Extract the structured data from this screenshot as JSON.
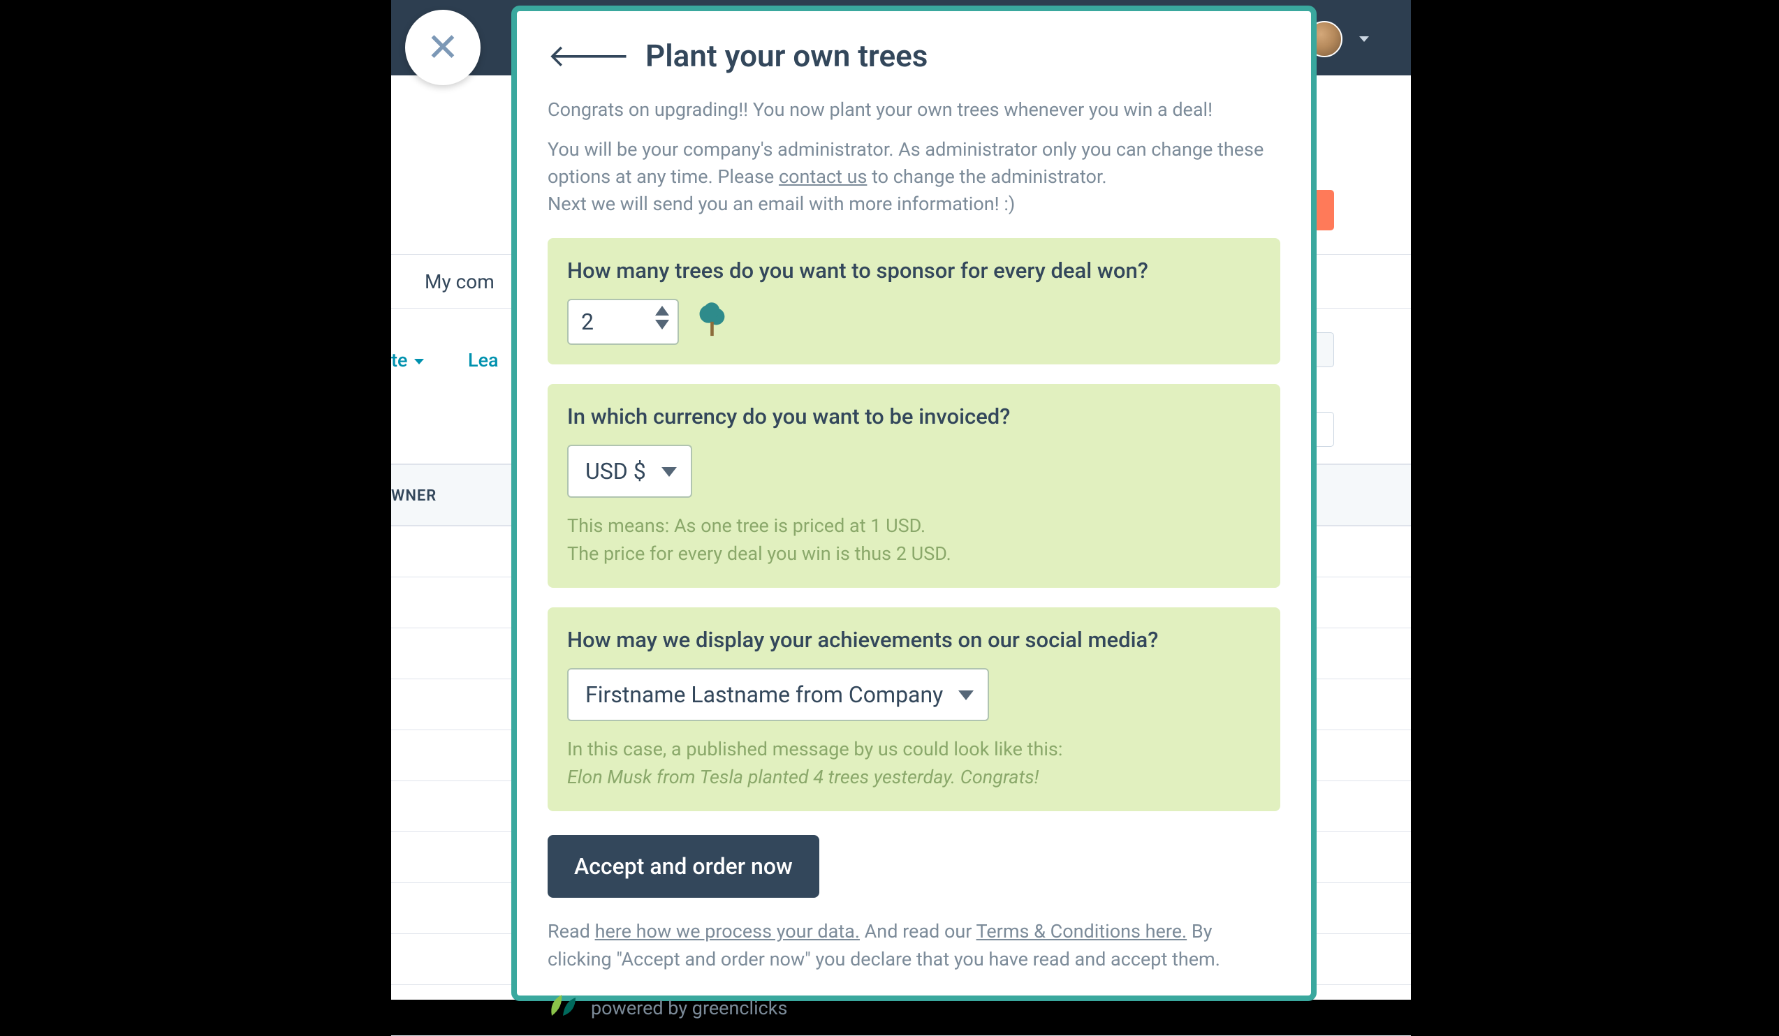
{
  "modal": {
    "title": "Plant your own trees",
    "intro1": "Congrats on upgrading!! You now plant your own trees whenever you win a deal!",
    "intro2a": "You will be your company's administrator. As administrator only you can change these options at any time. Please ",
    "contact_link": "contact us",
    "intro2b": "  to change the administrator.",
    "intro3": "Next we will send you an email with more information! :)"
  },
  "trees": {
    "question": "How many trees do you want to sponsor for every deal won?",
    "value": "2"
  },
  "currency": {
    "question": "In which currency do you want to be invoiced?",
    "selected": "USD $",
    "hint1": "This means: As one tree is priced at 1 USD.",
    "hint2": "The price for every deal you win is thus 2 USD."
  },
  "social": {
    "question": "How may we display your achievements on our social media?",
    "selected": "Firstname Lastname from Company",
    "hint1": "In this case, a published message by us could look like this:",
    "example": "Elon Musk from Tesla planted 4 trees yesterday. Congrats!"
  },
  "accept": {
    "button": "Accept and order now",
    "read": "Read ",
    "data_link": "here how we process your data.",
    "and": " And read our ",
    "terms_link": "Terms & Conditions here.",
    "tail": " By clicking \"Accept and order now\" you declare that you have read and accept them."
  },
  "powered": "powered by greenclicks",
  "bg": {
    "tab": "My com",
    "filter1": "te",
    "filter2": "Lea",
    "col": "WNER"
  }
}
